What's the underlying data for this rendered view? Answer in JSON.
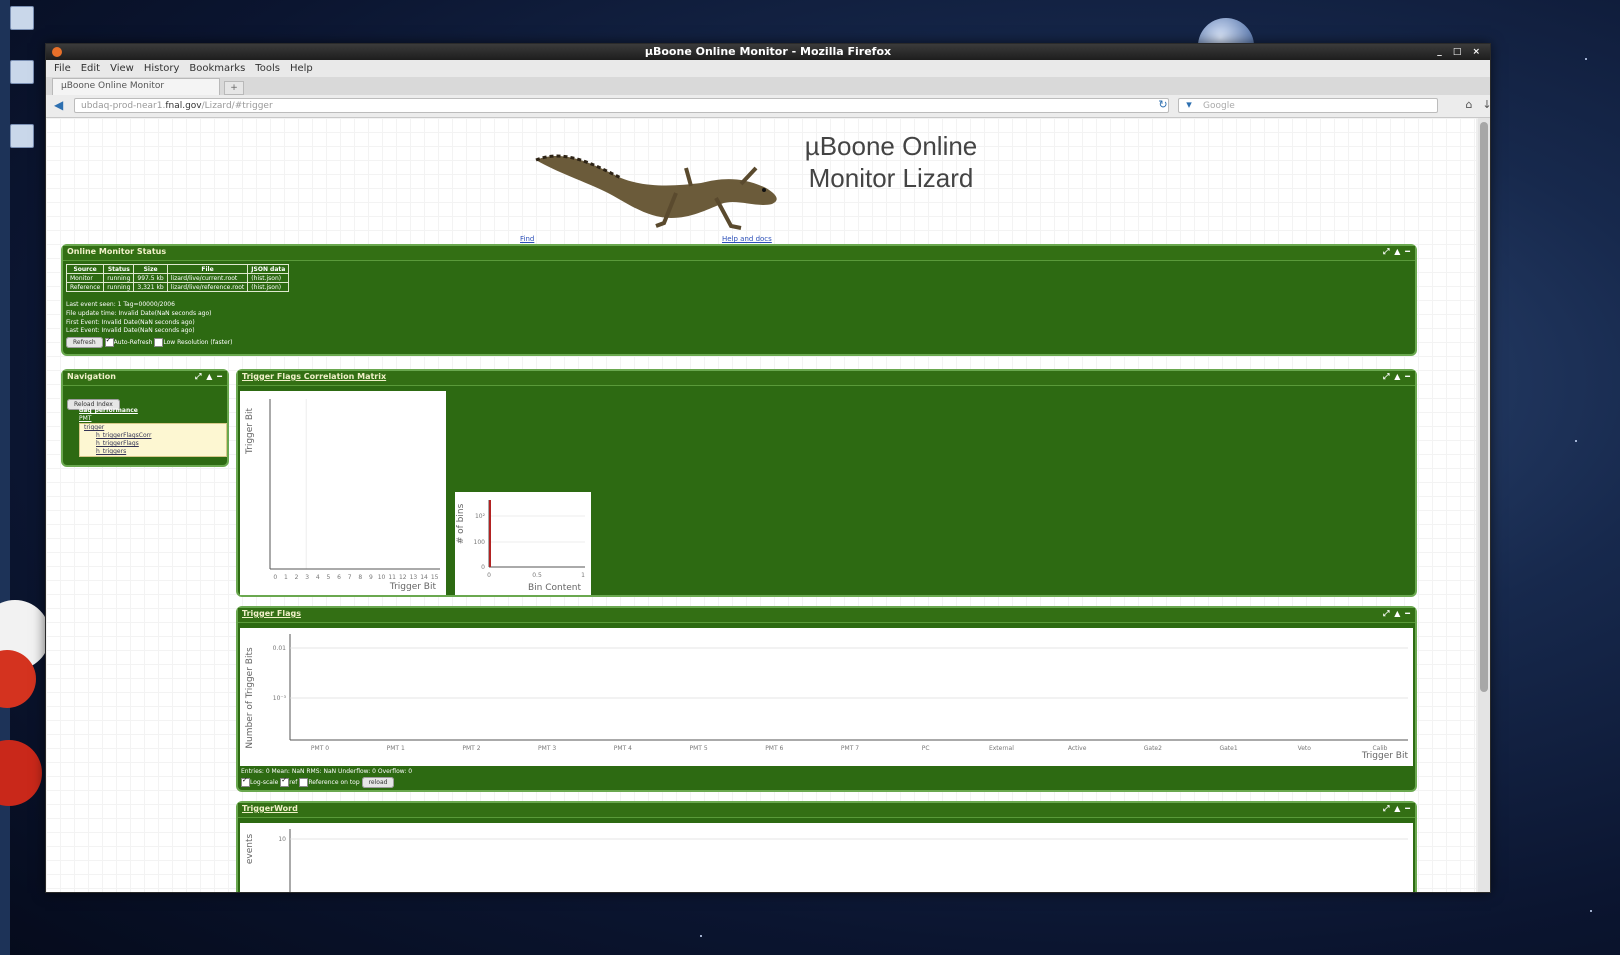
{
  "window": {
    "title": "µBoone Online Monitor - Mozilla Firefox",
    "controls": "_ □ ×"
  },
  "menu": [
    "File",
    "Edit",
    "View",
    "History",
    "Bookmarks",
    "Tools",
    "Help"
  ],
  "tab": {
    "label": "µBoone Online Monitor",
    "new_tab": "+"
  },
  "navbar": {
    "url_prefix": "ubdaq-prod-near1.",
    "url_host": "fnal.gov",
    "url_rest": "/Lizard/#trigger",
    "search_placeholder": "Google"
  },
  "page": {
    "title_line1": "µBoone Online",
    "title_line2": "Monitor Lizard",
    "link_left": "Find",
    "link_right": "Help and docs"
  },
  "status_panel": {
    "title": "Online Monitor Status",
    "columns": [
      "Source",
      "Status",
      "Size",
      "File",
      "JSON data"
    ],
    "rows": [
      [
        "Monitor",
        "running",
        "997.5 kb",
        "lizard/live/current.root",
        "(hist.json)"
      ],
      [
        "Reference",
        "running",
        "3,321 kb",
        "lizard/live/reference.root",
        "(hist.json)"
      ]
    ],
    "lines": [
      "Last event seen: 1 Tag=00000/2006",
      "File update time: Invalid Date(NaN seconds ago)",
      "First Event: Invalid Date(NaN seconds ago)",
      "Last Event: Invalid Date(NaN seconds ago)"
    ],
    "refresh_label": "Refresh",
    "auto_refresh_label": "Auto-Refresh",
    "auto_refresh_checked": true,
    "low_res_label": "Low Resolution (faster)",
    "low_res_checked": false
  },
  "navigation": {
    "title": "Navigation",
    "reload_label": "Reload Index",
    "items": [
      "daq_performance",
      "PMT",
      "trigger",
      "h_triggerFlagsCorr",
      "h_triggerFlags",
      "h_triggers"
    ]
  },
  "corr_panel": {
    "title": "Trigger Flags Correlation Matrix",
    "y_label": "Trigger Bit",
    "x_label": "Trigger Bit",
    "x_ticks": [
      "0",
      "1",
      "2",
      "3",
      "4",
      "5",
      "6",
      "7",
      "8",
      "9",
      "10",
      "11",
      "12",
      "13",
      "14",
      "15"
    ],
    "hist": {
      "y_label": "# of bins",
      "x_label": "Bin Content",
      "y_ticks": [
        "10²",
        "100",
        "0"
      ],
      "x_ticks": [
        "0",
        "0.5",
        "1"
      ]
    }
  },
  "flags_panel": {
    "title": "Trigger Flags",
    "y_label": "Number of Trigger Bits",
    "x_label": "Trigger Bit",
    "y_ticks": [
      "0.01",
      "10⁻³"
    ],
    "stats": "Entries: 0 Mean: NaN RMS: NaN Underflow: 0 Overflow: 0",
    "log_scale_label": "Log-scale",
    "log_scale_checked": true,
    "ref_label": "ref",
    "ref_checked": true,
    "ref_on_top_label": "Reference on top",
    "ref_on_top_checked": false,
    "reload_label": "reload"
  },
  "trigger_word_panel": {
    "title": "TriggerWord",
    "y_label": "events",
    "y_tick": "10"
  },
  "colors": {
    "panel_green": "#2d6a12",
    "panel_border": "#6aa84f",
    "highlight_bar": "#b22222"
  },
  "chart_data": [
    {
      "type": "heatmap",
      "title": "Trigger Flags Correlation Matrix",
      "xlabel": "Trigger Bit",
      "ylabel": "Trigger Bit",
      "x": [
        "0",
        "1",
        "2",
        "3",
        "4",
        "5",
        "6",
        "7",
        "8",
        "9",
        "10",
        "11",
        "12",
        "13",
        "14",
        "15"
      ],
      "values": []
    },
    {
      "type": "bar",
      "title": "",
      "xlabel": "Bin Content",
      "ylabel": "# of bins",
      "xlim": [
        0,
        1
      ],
      "categories": [
        "0"
      ],
      "values": [
        256
      ]
    },
    {
      "type": "bar",
      "title": "Trigger Flags",
      "xlabel": "Trigger Bit",
      "ylabel": "Number of Trigger Bits",
      "categories": [
        "PMT 0",
        "PMT 1",
        "PMT 2",
        "PMT 3",
        "PMT 4",
        "PMT 5",
        "PMT 6",
        "PMT 7",
        "PC",
        "External",
        "Active",
        "Gate2",
        "Gate1",
        "Veto",
        "Calib"
      ],
      "values": [
        0,
        0,
        0,
        0,
        0,
        0,
        0,
        0,
        0,
        0,
        0,
        0,
        0,
        0,
        0
      ],
      "ylim": [
        0.0005,
        0.02
      ],
      "log_y": true,
      "grid": true
    }
  ]
}
